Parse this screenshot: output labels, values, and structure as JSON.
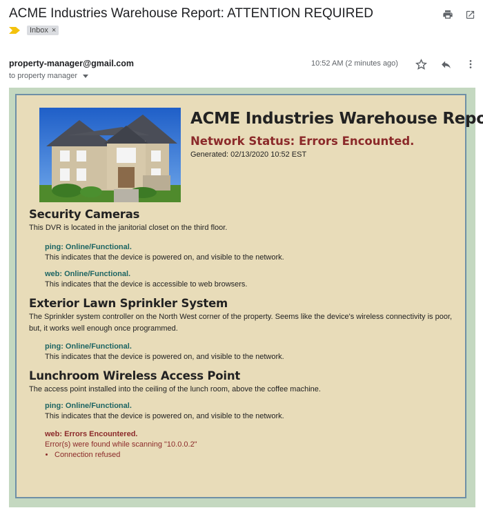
{
  "email": {
    "subject": "ACME Industries Warehouse Report: ATTENTION REQUIRED",
    "label_chip": "Inbox",
    "label_chip_close": "×",
    "sender": "property-manager@gmail.com",
    "recipient": "to property manager",
    "time": "10:52 AM (2 minutes ago)",
    "icons": {
      "print": "print-icon",
      "open_new": "open-in-new-window-icon",
      "importance": "importance-marker-icon",
      "star": "star-icon",
      "reply": "reply-icon",
      "more": "more-vertical-icon",
      "dropdown": "chevron-down-icon"
    }
  },
  "report": {
    "title": "ACME Industries Warehouse Report",
    "network_status": "Network Status: Errors Encounted.",
    "generated": "Generated: 02/13/2020 10:52 EST",
    "image": "house-photo",
    "colors": {
      "outer_frame": "#c4d8c0",
      "panel": "#e8dcb9",
      "panel_border": "#6e8fa6",
      "ok_text": "#1d6563",
      "error_text": "#8b2a2a"
    },
    "sections": [
      {
        "heading": "Security Cameras",
        "description": "This DVR is located in the janitorial closet on the third floor.",
        "checks": [
          {
            "title": "ping: Online/Functional.",
            "desc": "This indicates that the device is powered on, and visible to the network."
          },
          {
            "title": "web: Online/Functional.",
            "desc": "This indicates that the device is accessible to web browsers."
          }
        ]
      },
      {
        "heading": "Exterior Lawn Sprinkler System",
        "description": "The Sprinkler system controller on the North West corner of the property. Seems like the device's wireless connectivity is poor, but, it works well enough once programmed.",
        "checks": [
          {
            "title": "ping: Online/Functional.",
            "desc": "This indicates that the device is powered on, and visible to the network."
          }
        ]
      },
      {
        "heading": "Lunchroom Wireless Access Point",
        "description": "The access point installed into the ceiling of the lunch room, above the coffee machine.",
        "checks": [
          {
            "title": "ping: Online/Functional.",
            "desc": "This indicates that the device is powered on, and visible to the network."
          },
          {
            "title": "web: Errors Encountered.",
            "desc": "Error(s) were found while scanning \"10.0.0.2\"",
            "error": true,
            "errors": [
              "Connection refused"
            ]
          }
        ]
      }
    ]
  }
}
